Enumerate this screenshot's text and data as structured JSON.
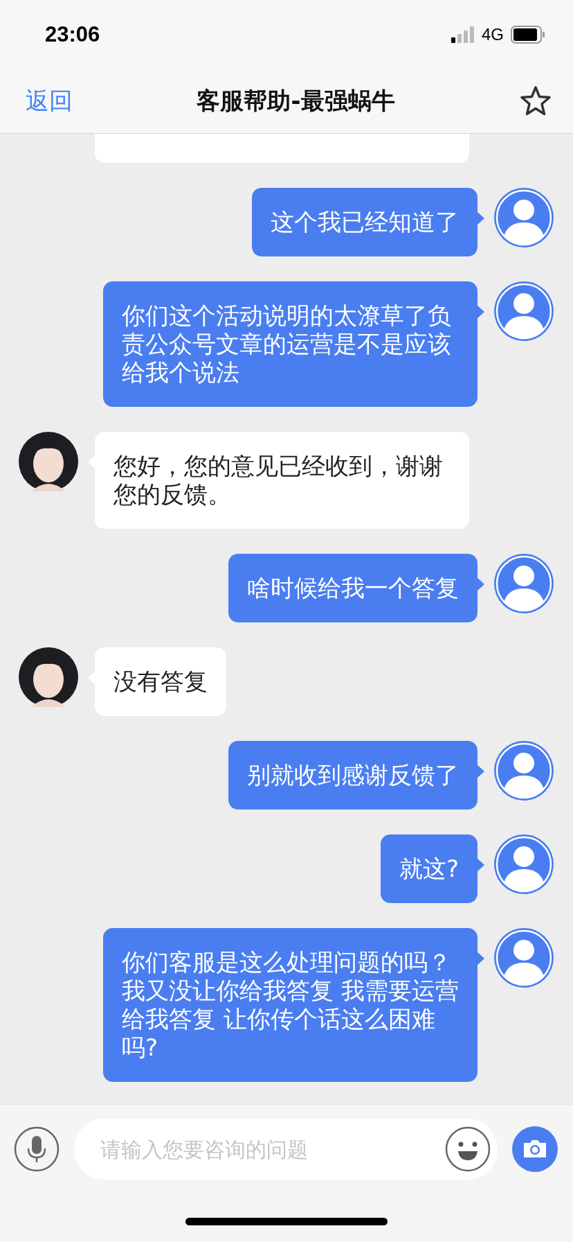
{
  "status_bar": {
    "time": "23:06",
    "network": "4G"
  },
  "header": {
    "back": "返回",
    "title": "客服帮助-最强蜗牛"
  },
  "messages": [
    {
      "kind": "agent_cut"
    },
    {
      "kind": "user",
      "text": "这个我已经知道了"
    },
    {
      "kind": "user",
      "text": "你们这个活动说明的太潦草了负责公众号文章的运营是不是应该给我个说法"
    },
    {
      "kind": "agent",
      "text": "您好，您的意见已经收到，谢谢您的反馈。"
    },
    {
      "kind": "user",
      "text": "啥时候给我一个答复"
    },
    {
      "kind": "agent",
      "text": "没有答复"
    },
    {
      "kind": "user",
      "text": "别就收到感谢反馈了"
    },
    {
      "kind": "user",
      "text": "就这?"
    },
    {
      "kind": "user",
      "text": "你们客服是这么处理问题的吗？我又没让你给我答复 我需要运营给我答复 让你传个话这么困难吗?"
    }
  ],
  "input": {
    "placeholder": "请输入您要咨询的问题"
  }
}
